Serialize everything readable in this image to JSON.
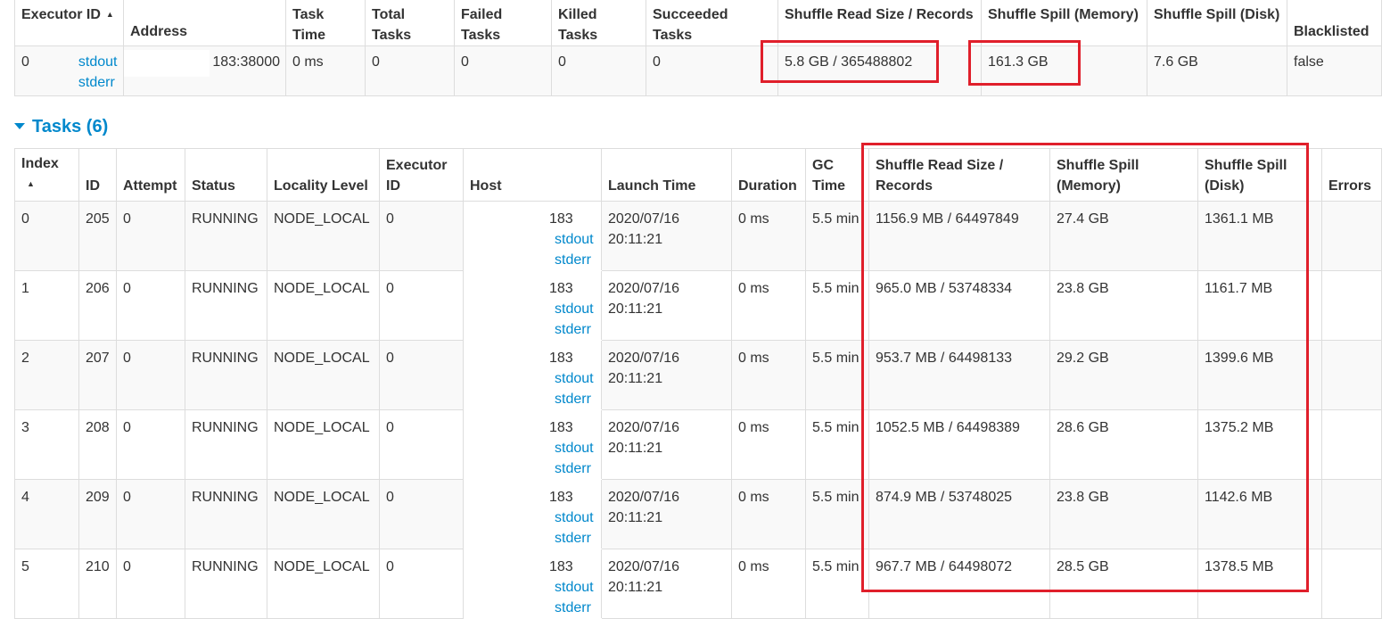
{
  "executor_table": {
    "headers": [
      "Executor ID",
      "Address",
      "Task Time",
      "Total Tasks",
      "Failed Tasks",
      "Killed Tasks",
      "Succeeded Tasks",
      "Shuffle Read Size / Records",
      "Shuffle Spill (Memory)",
      "Shuffle Spill (Disk)",
      "Blacklisted"
    ],
    "sort_indicator": "▲",
    "row": {
      "executor_id": "0",
      "stdout": "stdout",
      "stderr": "stderr",
      "address_suffix": "183:38000",
      "task_time": "0 ms",
      "total_tasks": "0",
      "failed_tasks": "0",
      "killed_tasks": "0",
      "succeeded_tasks": "0",
      "shuffle_read": "5.8 GB / 365488802",
      "spill_memory": "161.3 GB",
      "spill_disk": "7.6 GB",
      "blacklisted": "false"
    }
  },
  "tasks_section": {
    "title": "Tasks (6)",
    "headers": [
      "Index",
      "ID",
      "Attempt",
      "Status",
      "Locality Level",
      "Executor ID",
      "Host",
      "Launch Time",
      "Duration",
      "GC Time",
      "Shuffle Read Size / Records",
      "Shuffle Spill (Memory)",
      "Shuffle Spill (Disk)",
      "Errors"
    ],
    "sort_indicator": "▲",
    "rows": [
      {
        "index": "0",
        "id": "205",
        "attempt": "0",
        "status": "RUNNING",
        "locality": "NODE_LOCAL",
        "executor_id": "0",
        "host": "183",
        "stdout": "stdout",
        "stderr": "stderr",
        "launch_date": "2020/07/16",
        "launch_time": "20:11:21",
        "duration": "0 ms",
        "gc_time": "5.5 min",
        "shuffle_read": "1156.9 MB / 64497849",
        "spill_memory": "27.4 GB",
        "spill_disk": "1361.1 MB",
        "errors": ""
      },
      {
        "index": "1",
        "id": "206",
        "attempt": "0",
        "status": "RUNNING",
        "locality": "NODE_LOCAL",
        "executor_id": "0",
        "host": "183",
        "stdout": "stdout",
        "stderr": "stderr",
        "launch_date": "2020/07/16",
        "launch_time": "20:11:21",
        "duration": "0 ms",
        "gc_time": "5.5 min",
        "shuffle_read": "965.0 MB / 53748334",
        "spill_memory": "23.8 GB",
        "spill_disk": "1161.7 MB",
        "errors": ""
      },
      {
        "index": "2",
        "id": "207",
        "attempt": "0",
        "status": "RUNNING",
        "locality": "NODE_LOCAL",
        "executor_id": "0",
        "host": "183",
        "stdout": "stdout",
        "stderr": "stderr",
        "launch_date": "2020/07/16",
        "launch_time": "20:11:21",
        "duration": "0 ms",
        "gc_time": "5.5 min",
        "shuffle_read": "953.7 MB / 64498133",
        "spill_memory": "29.2 GB",
        "spill_disk": "1399.6 MB",
        "errors": ""
      },
      {
        "index": "3",
        "id": "208",
        "attempt": "0",
        "status": "RUNNING",
        "locality": "NODE_LOCAL",
        "executor_id": "0",
        "host": "183",
        "stdout": "stdout",
        "stderr": "stderr",
        "launch_date": "2020/07/16",
        "launch_time": "20:11:21",
        "duration": "0 ms",
        "gc_time": "5.5 min",
        "shuffle_read": "1052.5 MB / 64498389",
        "spill_memory": "28.6 GB",
        "spill_disk": "1375.2 MB",
        "errors": ""
      },
      {
        "index": "4",
        "id": "209",
        "attempt": "0",
        "status": "RUNNING",
        "locality": "NODE_LOCAL",
        "executor_id": "0",
        "host": "183",
        "stdout": "stdout",
        "stderr": "stderr",
        "launch_date": "2020/07/16",
        "launch_time": "20:11:21",
        "duration": "0 ms",
        "gc_time": "5.5 min",
        "shuffle_read": "874.9 MB / 53748025",
        "spill_memory": "23.8 GB",
        "spill_disk": "1142.6 MB",
        "errors": ""
      },
      {
        "index": "5",
        "id": "210",
        "attempt": "0",
        "status": "RUNNING",
        "locality": "NODE_LOCAL",
        "executor_id": "0",
        "host": "183",
        "stdout": "stdout",
        "stderr": "stderr",
        "launch_date": "2020/07/16",
        "launch_time": "20:11:21",
        "duration": "0 ms",
        "gc_time": "5.5 min",
        "shuffle_read": "967.7 MB / 64498072",
        "spill_memory": "28.5 GB",
        "spill_disk": "1378.5 MB",
        "errors": ""
      }
    ]
  },
  "colors": {
    "link": "#0088cc",
    "highlight": "#e01f2b",
    "border": "#dddddd",
    "stripe": "#f9f9f9",
    "text": "#333333"
  }
}
